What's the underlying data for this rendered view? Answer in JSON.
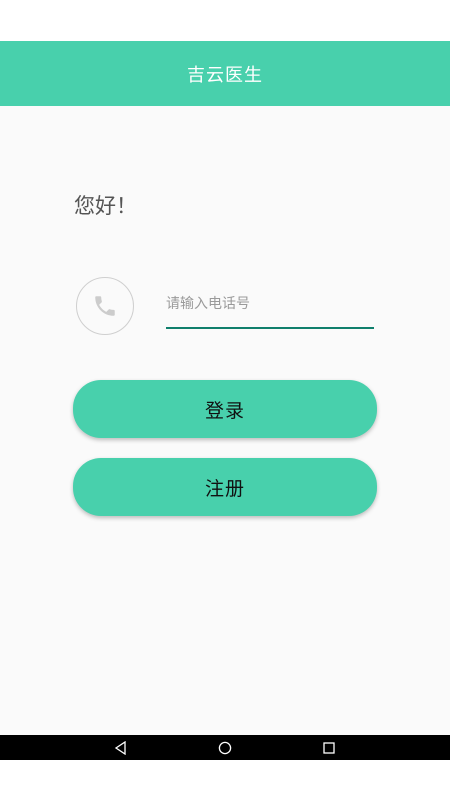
{
  "app": {
    "title": "吉云医生"
  },
  "login": {
    "greeting": "您好！",
    "phone_placeholder": "请输入电话号",
    "phone_value": "",
    "login_label": "登录",
    "register_label": "注册"
  },
  "icons": {
    "phone": "phone-icon",
    "nav_back": "back-triangle-icon",
    "nav_home": "home-circle-icon",
    "nav_recents": "recents-square-icon"
  },
  "colors": {
    "accent": "#48d0ac",
    "input_underline": "#0f7f6c",
    "background": "#fafafa"
  }
}
